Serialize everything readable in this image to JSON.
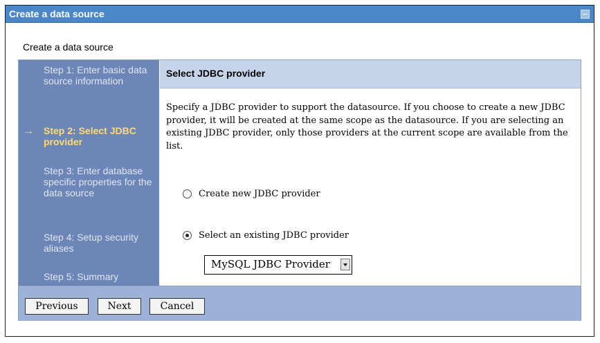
{
  "window": {
    "title": "Create a data source"
  },
  "page": {
    "subtitle": "Create a data source"
  },
  "steps": [
    {
      "label": "Step 1: Enter basic data source information",
      "active": false
    },
    {
      "label": "Step 2: Select JDBC provider",
      "active": true
    },
    {
      "label": "Step 3: Enter database specific properties for the data source",
      "active": false
    },
    {
      "label": "Step 4: Setup security aliases",
      "active": false
    },
    {
      "label": "Step 5: Summary",
      "active": false
    }
  ],
  "content": {
    "header": "Select JDBC provider",
    "description": "Specify a JDBC provider to support the datasource. If you choose to create a new JDBC provider, it will be created at the same scope as the datasource. If you are selecting an existing JDBC provider, only those providers at the current scope are available from the list.",
    "options": [
      {
        "label": "Create new JDBC provider",
        "checked": false
      },
      {
        "label": "Select an existing JDBC provider",
        "checked": true
      }
    ],
    "provider_select": {
      "value": "MySQL JDBC Provider"
    }
  },
  "buttons": {
    "previous": "Previous",
    "next": "Next",
    "cancel": "Cancel"
  },
  "colors": {
    "titlebar": "#4a86c8",
    "step_panel": "#6d86b8",
    "active_step": "#ffdc73",
    "header_band": "#c5d4ea",
    "button_bar": "#9cb2d6"
  },
  "icons": {
    "current_step": "arrow-right-icon",
    "window_minimize": "minimize-icon",
    "dropdown": "chevron-down-icon"
  }
}
